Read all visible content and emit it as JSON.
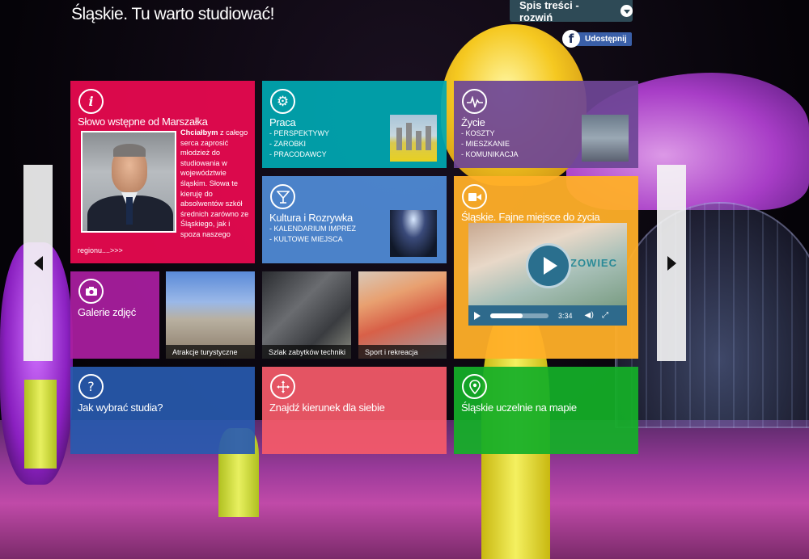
{
  "header": {
    "title": "Śląskie. Tu warto studiować!",
    "toc_label": "Spis treści - rozwiń",
    "share_label": "Udostępnij",
    "fb_glyph": "f"
  },
  "tiles": {
    "marshal": {
      "title": "Słowo wstępne od Marszałka",
      "icon": "info-icon",
      "icon_glyph": "i",
      "text_bold": "Chciałbym",
      "text": " z całego serca zaprosić młodzież do studiowania w województwie śląskim. Słowa te kieruję do absolwentów szkół średnich zarówno ze Śląskiego, jak i spoza naszego",
      "more": "regionu....>>>",
      "color": "#e80a50"
    },
    "praca": {
      "title": "Praca",
      "icon": "gear-icon",
      "icon_glyph": "⚙",
      "items": [
        "PERSPEKTYWY",
        "ZAROBKI",
        "PRACODAWCY"
      ],
      "color": "#00a8b2"
    },
    "zycie": {
      "title": "Życie",
      "icon": "heartbeat-icon",
      "items": [
        "KOSZTY",
        "MIESZKANIE",
        "KOMUNIKACJA"
      ],
      "color": "#6e4696"
    },
    "kultura": {
      "title": "Kultura i Rozrywka",
      "icon": "cocktail-icon",
      "icon_glyph": "🍸",
      "items": [
        "KALENDARIUM IMPREZ",
        "KULTOWE MIEJSCA"
      ],
      "color": "#508cd7"
    },
    "fajne": {
      "title": "Śląskie. Fajne miejsce do życia",
      "icon": "video-camera-icon",
      "icon_glyph": "▶",
      "video": {
        "brand_text": "ZOWIEC",
        "time": "3:34",
        "progress": 0.55,
        "volume_glyph": "◀)",
        "fullscreen_glyph": "⤢"
      },
      "color": "#ffaf28"
    },
    "galerie": {
      "title": "Galerie zdjęć",
      "icon": "camera-icon",
      "icon_glyph": "📷",
      "color": "#aa1ea0"
    },
    "gallery_items": [
      {
        "caption": "Atrakcje turystyczne"
      },
      {
        "caption": "Szlak zabytków techniki"
      },
      {
        "caption": "Sport i rekreacja"
      }
    ],
    "jak": {
      "title": "Jak wybrać studia?",
      "icon": "question-icon",
      "icon_glyph": "?",
      "color": "#285aaf"
    },
    "znajdz": {
      "title": "Znajdź kierunek dla siebie",
      "icon": "arrows-icon",
      "icon_glyph": "✥",
      "color": "#f55a69"
    },
    "mapa": {
      "title": "Śląskie uczelnie na mapie",
      "icon": "map-pin-icon",
      "icon_glyph": "📍",
      "color": "#14af28"
    }
  }
}
